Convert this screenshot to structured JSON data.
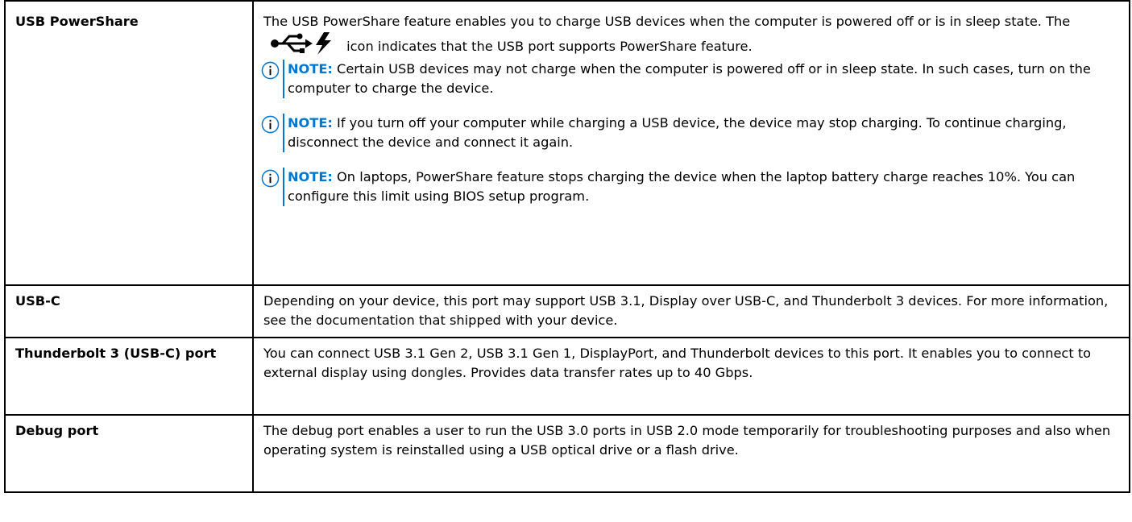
{
  "rows": [
    {
      "term": "USB PowerShare",
      "description": {
        "before_icon": "The USB PowerShare feature enables you to charge USB devices when the computer is powered off or is in sleep state. The",
        "after_icon": "icon indicates that the USB port supports PowerShare feature."
      },
      "notes": [
        {
          "label": "NOTE:",
          "text": "Certain USB devices may not charge when the computer is powered off or in sleep state. In such cases, turn on the computer to charge the device."
        },
        {
          "label": "NOTE:",
          "text": "If you turn off your computer while charging a USB device, the device may stop charging. To continue charging, disconnect the device and connect it again."
        },
        {
          "label": "NOTE:",
          "text": "On laptops, PowerShare feature stops charging the device when the laptop battery charge reaches 10%. You can configure this limit using BIOS setup program."
        }
      ]
    },
    {
      "term": "USB-C",
      "description": "Depending on your device, this port may support USB 3.1, Display over USB-C, and Thunderbolt 3 devices. For more information, see the documentation that shipped with your device."
    },
    {
      "term": "Thunderbolt 3 (USB-C) port",
      "description": "You can connect USB 3.1 Gen 2, USB 3.1 Gen 1, DisplayPort, and Thunderbolt devices to this port. It enables you to connect to external display using dongles. Provides data transfer rates up to 40 Gbps."
    },
    {
      "term": "Debug port",
      "description": "The debug port enables a user to run the USB 3.0 ports in USB 2.0 mode temporarily for troubleshooting purposes and also when operating system is reinstalled using a USB optical drive or a flash drive."
    }
  ],
  "icons": {
    "powershare": "usb-powershare-icon",
    "note": "info-icon"
  },
  "colors": {
    "note_accent": "#0076ce",
    "text": "#000000",
    "border": "#000000"
  }
}
